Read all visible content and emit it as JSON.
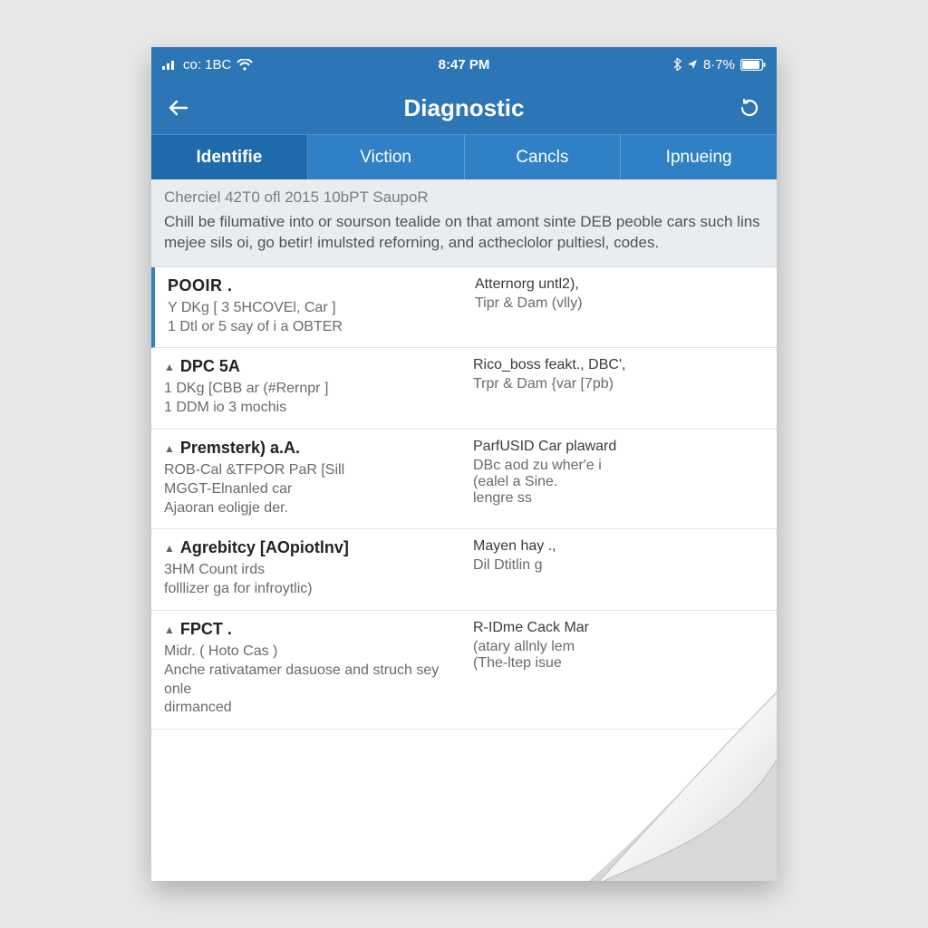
{
  "statusbar": {
    "carrier": "co: 1BC",
    "time": "8:47 PM",
    "battery_text": "8·7%"
  },
  "header": {
    "title": "Diagnostic"
  },
  "tabs": [
    {
      "label": "Identifie",
      "active": true
    },
    {
      "label": "Viction",
      "active": false
    },
    {
      "label": "Cancls",
      "active": false
    },
    {
      "label": "Ipnueing",
      "active": false
    }
  ],
  "intro": {
    "heading": "Cherciel 42T0 ofl 2015 10bPT SaupoR",
    "body": "Chill be filumative into or sourson tealide on that amont sinte DEB peoble cars such lins mejee sils oi, go betir! imulsted reforning, and actheclolor pultiesl, codes."
  },
  "items": [
    {
      "title": "POOIR .",
      "left1": "Y DKg [ 3 5HCOVEl, Car ]",
      "left2": "1 Dtl or 5 say of i a OBTER",
      "right1": "Atternorg untl2),",
      "right2": "Tipr & Dam (vlly)"
    },
    {
      "title": "DPC  5A",
      "left1": "1 DKg [CBB ar  (#Rernpr ]",
      "left2": "1 DDM io 3 mochis",
      "right1": "Rico_boss feakt., DBC',",
      "right2": "Trpr & Dam {var [7pb)"
    },
    {
      "title": "Premsterk)  a.A.",
      "left1": "ROB-Cal &TFPOR PaR  [Sill",
      "left2": "MGGT-Elnanled car",
      "left3": "Ajaoran eoligje der.",
      "right1": "ParfUSID Car plaward",
      "right2": "DBc aod zu wher'e i",
      "right3": "(ealel a Sine.",
      "right4": "lengre ss"
    },
    {
      "title": "Agrebitcy  [AOpiotlnv]",
      "left1": "3HM Count irds",
      "left2": "folllizer ga for infroytlic)",
      "right1": "Mayen hay .,",
      "right2": "Dil Dtitlin  g"
    },
    {
      "title": "FPCT .",
      "left1": "Midr. ( Hoto Cas )",
      "left2": "Anche rativatamer dasuose and struch sey onle",
      "left3": "dirmanced",
      "right1": "R-IDme Cack Mar",
      "right2": "(atary allnly lem",
      "right3": "(The-ltep isue"
    }
  ],
  "colors": {
    "brand_primary": "#2d76b6",
    "brand_tab": "#2f80c4",
    "accent_border": "#2f80c4"
  }
}
